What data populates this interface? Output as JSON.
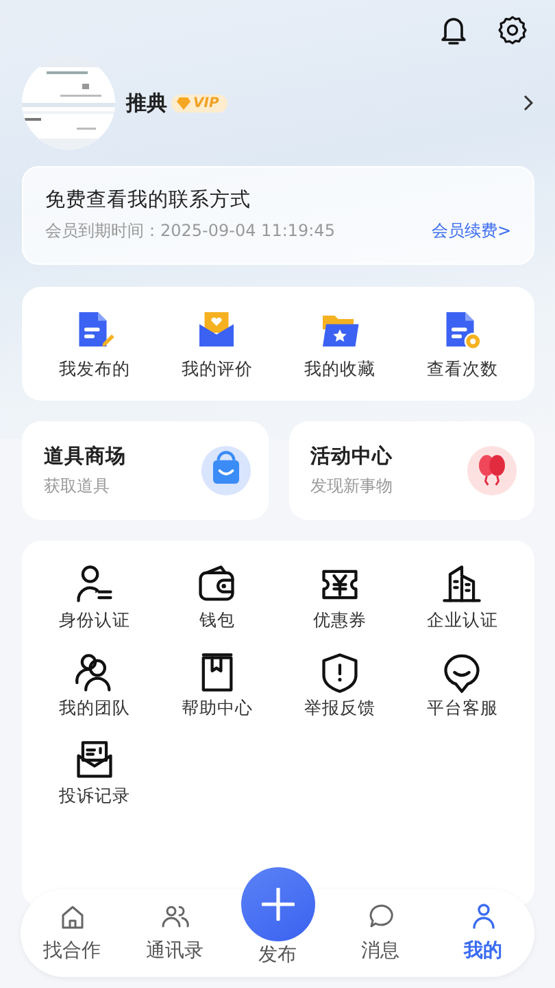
{
  "header": {
    "name": "推典",
    "badge": "VIP"
  },
  "member": {
    "title": "免费查看我的联系方式",
    "expiry_label": "会员到期时间：",
    "expiry": "2025-09-04 11:19:45",
    "renew": "会员续费>"
  },
  "quick_actions": [
    {
      "label": "我发布的"
    },
    {
      "label": "我的评价"
    },
    {
      "label": "我的收藏"
    },
    {
      "label": "查看次数"
    }
  ],
  "promos": [
    {
      "title": "道具商场",
      "subtitle": "获取道具"
    },
    {
      "title": "活动中心",
      "subtitle": "发现新事物"
    }
  ],
  "tools": [
    {
      "label": "身份认证"
    },
    {
      "label": "钱包"
    },
    {
      "label": "优惠券"
    },
    {
      "label": "企业认证"
    },
    {
      "label": "我的团队"
    },
    {
      "label": "帮助中心"
    },
    {
      "label": "举报反馈"
    },
    {
      "label": "平台客服"
    },
    {
      "label": "投诉记录"
    }
  ],
  "tab_bar": [
    {
      "label": "找合作",
      "kind": "tab",
      "selected": false
    },
    {
      "label": "通讯录",
      "kind": "tab",
      "selected": false
    },
    {
      "label": "发布",
      "kind": "publish",
      "selected": false
    },
    {
      "label": "消息",
      "kind": "tab",
      "selected": false
    },
    {
      "label": "我的",
      "kind": "tab",
      "selected": true
    }
  ]
}
